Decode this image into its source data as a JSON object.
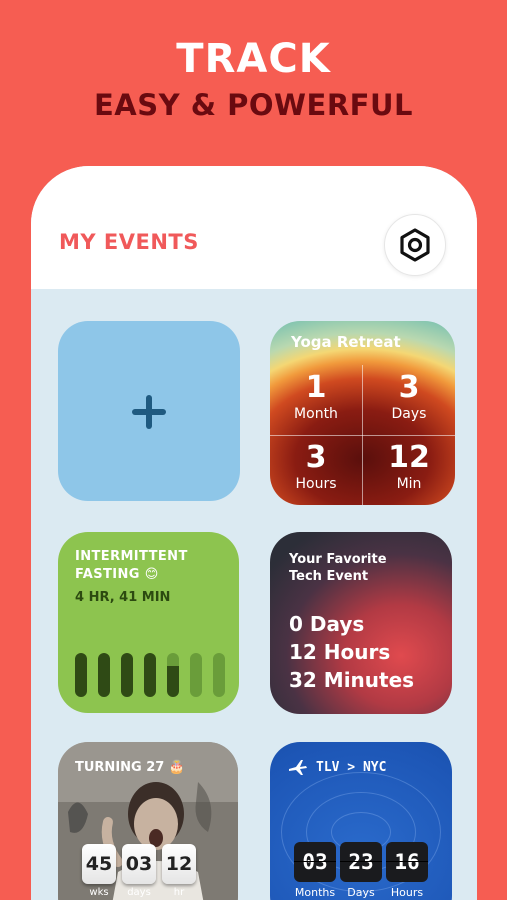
{
  "hero": {
    "title": "TRACK",
    "subtitle": "EASY & POWERFUL"
  },
  "header": {
    "title": "MY EVENTS",
    "settings_icon": "hexagon-nut-icon"
  },
  "colors": {
    "background": "#f65d52",
    "accent": "#f0595a",
    "subtitle": "#6a0a10",
    "add_tile": "#8ec6e8"
  },
  "add_tile": {
    "icon": "plus-icon"
  },
  "yoga": {
    "title": "Yoga Retreat",
    "cells": [
      {
        "num": "1",
        "unit": "Month"
      },
      {
        "num": "3",
        "unit": "Days"
      },
      {
        "num": "3",
        "unit": "Hours"
      },
      {
        "num": "12",
        "unit": "Min"
      }
    ]
  },
  "fasting": {
    "line1": "INTERMITTENT",
    "line2": "FASTING 😊",
    "time": "4 HR, 41 MIN",
    "bars": [
      "full",
      "full",
      "full",
      "full",
      "partial",
      "empty",
      "empty"
    ]
  },
  "tech": {
    "line1": "Your Favorite",
    "line2": "Tech Event",
    "days": "0 Days",
    "hours": "12 Hours",
    "minutes": "32 Minutes"
  },
  "turning": {
    "title": "TURNING 27 🎂",
    "counters": [
      {
        "value": "45",
        "unit": "wks"
      },
      {
        "value": "03",
        "unit": "days"
      },
      {
        "value": "12",
        "unit": "hr"
      }
    ]
  },
  "flight": {
    "route": "TLV > NYC",
    "icon": "airplane-icon",
    "counters": [
      {
        "value": "03",
        "unit": "Months"
      },
      {
        "value": "23",
        "unit": "Days"
      },
      {
        "value": "16",
        "unit": "Hours"
      }
    ]
  }
}
